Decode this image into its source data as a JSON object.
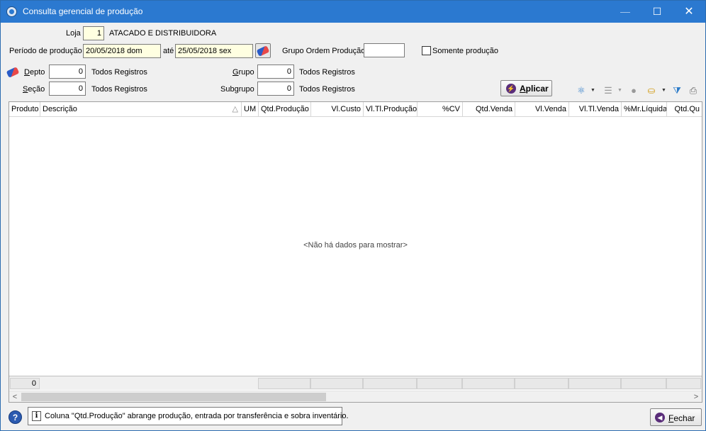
{
  "window": {
    "title": "Consulta gerencial de produção",
    "minimize": "—",
    "maximize": "☐",
    "close": "✕"
  },
  "filters": {
    "loja_label": "Loja",
    "loja_value": "1",
    "loja_name": "ATACADO E DISTRIBUIDORA",
    "periodo_label": "Período de produção",
    "periodo_start": "20/05/2018 dom",
    "ate_label": "até",
    "periodo_end": "25/05/2018 sex",
    "grupo_ordem_label": "Grupo Ordem Produção",
    "grupo_ordem_value": "",
    "somente_producao_label": "Somente produção",
    "depto_label": "Depto",
    "depto_value": "0",
    "depto_desc": "Todos Registros",
    "secao_label": "Seção",
    "secao_value": "0",
    "secao_desc": "Todos Registros",
    "grupo_label": "Grupo",
    "grupo_value": "0",
    "grupo_desc": "Todos Registros",
    "subgrupo_label": "Subgrupo",
    "subgrupo_value": "0",
    "subgrupo_desc": "Todos Registros",
    "aplicar_label": "Aplicar"
  },
  "grid": {
    "columns": [
      "Produto",
      "Descrição",
      "UM",
      "Qtd.Produção",
      "Vl.Custo",
      "Vl.Tl.Produção",
      "%CV",
      "Qtd.Venda",
      "Vl.Venda",
      "Vl.Tl.Venda",
      "%Mr.Líquida",
      "Qtd.Qu"
    ],
    "sort_indicator": "△",
    "empty_message": "<Não há dados para mostrar>",
    "footer_count": "0"
  },
  "status": {
    "help": "?",
    "info": "i",
    "message": "Coluna \"Qtd.Produção\" abrange produção, entrada por transferência e sobra inventário.",
    "fechar_label": "Fechar"
  },
  "icons": {
    "scroll_left": "<",
    "scroll_right": ">",
    "caret": "▼"
  }
}
